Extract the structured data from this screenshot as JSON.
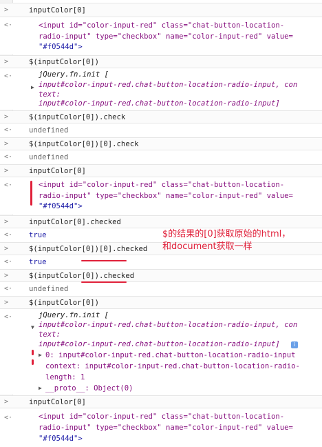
{
  "annotation": {
    "line1": "$的结果的[0]获取原始的html，",
    "line2": "和document获取一样"
  },
  "entries": [
    {
      "kind": "cmd",
      "text": "inputColor[0]"
    },
    {
      "kind": "html",
      "line1": "<input id=\"color-input-red\" class=\"chat-button-location-",
      "line2": "radio-input\" type=\"checkbox\" name=\"color-input-red\" value=",
      "line3": "\"#f0544d\">"
    },
    {
      "kind": "cmd",
      "text": "$(inputColor[0])"
    },
    {
      "kind": "jq",
      "l1": "jQuery.fn.init [",
      "l2": "input#color-input-red.chat-button-location-radio-input, con",
      "l3": "text:",
      "l4": "input#color-input-red.chat-button-location-radio-input]"
    },
    {
      "kind": "cmd",
      "text": "$(inputColor[0]).check"
    },
    {
      "kind": "res",
      "text": "undefined"
    },
    {
      "kind": "cmd",
      "text": "$(inputColor[0])[0].check"
    },
    {
      "kind": "res",
      "text": "undefined"
    },
    {
      "kind": "cmd",
      "text": "inputColor[0]"
    },
    {
      "kind": "html",
      "line1": "<input id=\"color-input-red\" class=\"chat-button-location-",
      "line2": "radio-input\" type=\"checkbox\" name=\"color-input-red\" value=",
      "line3": "\"#f0544d\">"
    },
    {
      "kind": "cmd",
      "text": "inputColor[0].checked"
    },
    {
      "kind": "res",
      "text": "true"
    },
    {
      "kind": "cmd",
      "text": "$(inputColor[0])[0].checked"
    },
    {
      "kind": "res",
      "text": "true"
    },
    {
      "kind": "cmd",
      "text": "$(inputColor[0]).checked"
    },
    {
      "kind": "res",
      "text": "undefined"
    },
    {
      "kind": "cmd",
      "text": "$(inputColor[0])"
    },
    {
      "kind": "jqx",
      "l1": "jQuery.fn.init [",
      "l2": "input#color-input-red.chat-button-location-radio-input, con",
      "l3": "text:",
      "l4": "input#color-input-red.chat-button-location-radio-input]",
      "i0": "0: input#color-input-red.chat-button-location-radio-input",
      "ctx": "context: input#color-input-red.chat-button-location-radio-",
      "len": "length: 1",
      "proto": "__proto__: Object(0)"
    },
    {
      "kind": "cmd",
      "text": "inputColor[0]"
    },
    {
      "kind": "html",
      "line1": "<input id=\"color-input-red\" class=\"chat-button-location-",
      "line2": "radio-input\" type=\"checkbox\" name=\"color-input-red\" value=",
      "line3": "\"#f0544d\">"
    }
  ]
}
